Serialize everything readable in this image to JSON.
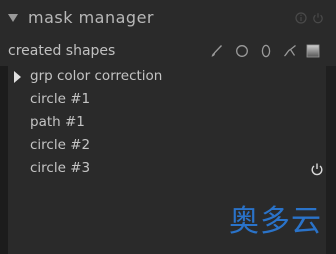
{
  "module": {
    "title": "mask manager"
  },
  "subheader": {
    "label": "created shapes",
    "tools": [
      "brush-icon",
      "circle-icon",
      "ellipse-icon",
      "path-icon",
      "gradient-icon"
    ]
  },
  "shapes": [
    {
      "label": "grp color correction",
      "type": "group",
      "expandable": true
    },
    {
      "label": "circle #1",
      "type": "circle"
    },
    {
      "label": "path #1",
      "type": "path"
    },
    {
      "label": "circle #2",
      "type": "circle"
    },
    {
      "label": "circle #3",
      "type": "circle",
      "power_icon": true
    }
  ],
  "watermark": {
    "text": "奥多云",
    "color": "#2a73c9"
  }
}
